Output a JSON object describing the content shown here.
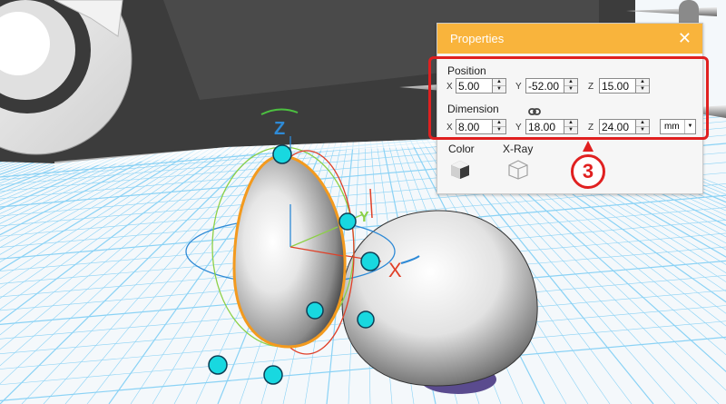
{
  "colors": {
    "panel_header": "#f9b43c",
    "highlight": "#e02020",
    "handle": "#18d8e0",
    "grid_line": "#8ad2f5"
  },
  "panel": {
    "title": "Properties",
    "close_icon": "close-icon",
    "position": {
      "label": "Position",
      "x": {
        "axis": "X",
        "value": "5.00"
      },
      "y": {
        "axis": "Y",
        "value": "-52.00"
      },
      "z": {
        "axis": "Z",
        "value": "15.00"
      }
    },
    "dimension": {
      "label": "Dimension",
      "link_icon": "link-icon",
      "x": {
        "axis": "X",
        "value": "8.00"
      },
      "y": {
        "axis": "Y",
        "value": "18.00"
      },
      "z": {
        "axis": "Z",
        "value": "24.00"
      },
      "unit": "mm"
    },
    "color_label": "Color",
    "xray_label": "X-Ray"
  },
  "annotation": {
    "callout_number": "3"
  },
  "gizmo": {
    "z_label": "Z",
    "y_label": "Y",
    "x_label": "X"
  }
}
